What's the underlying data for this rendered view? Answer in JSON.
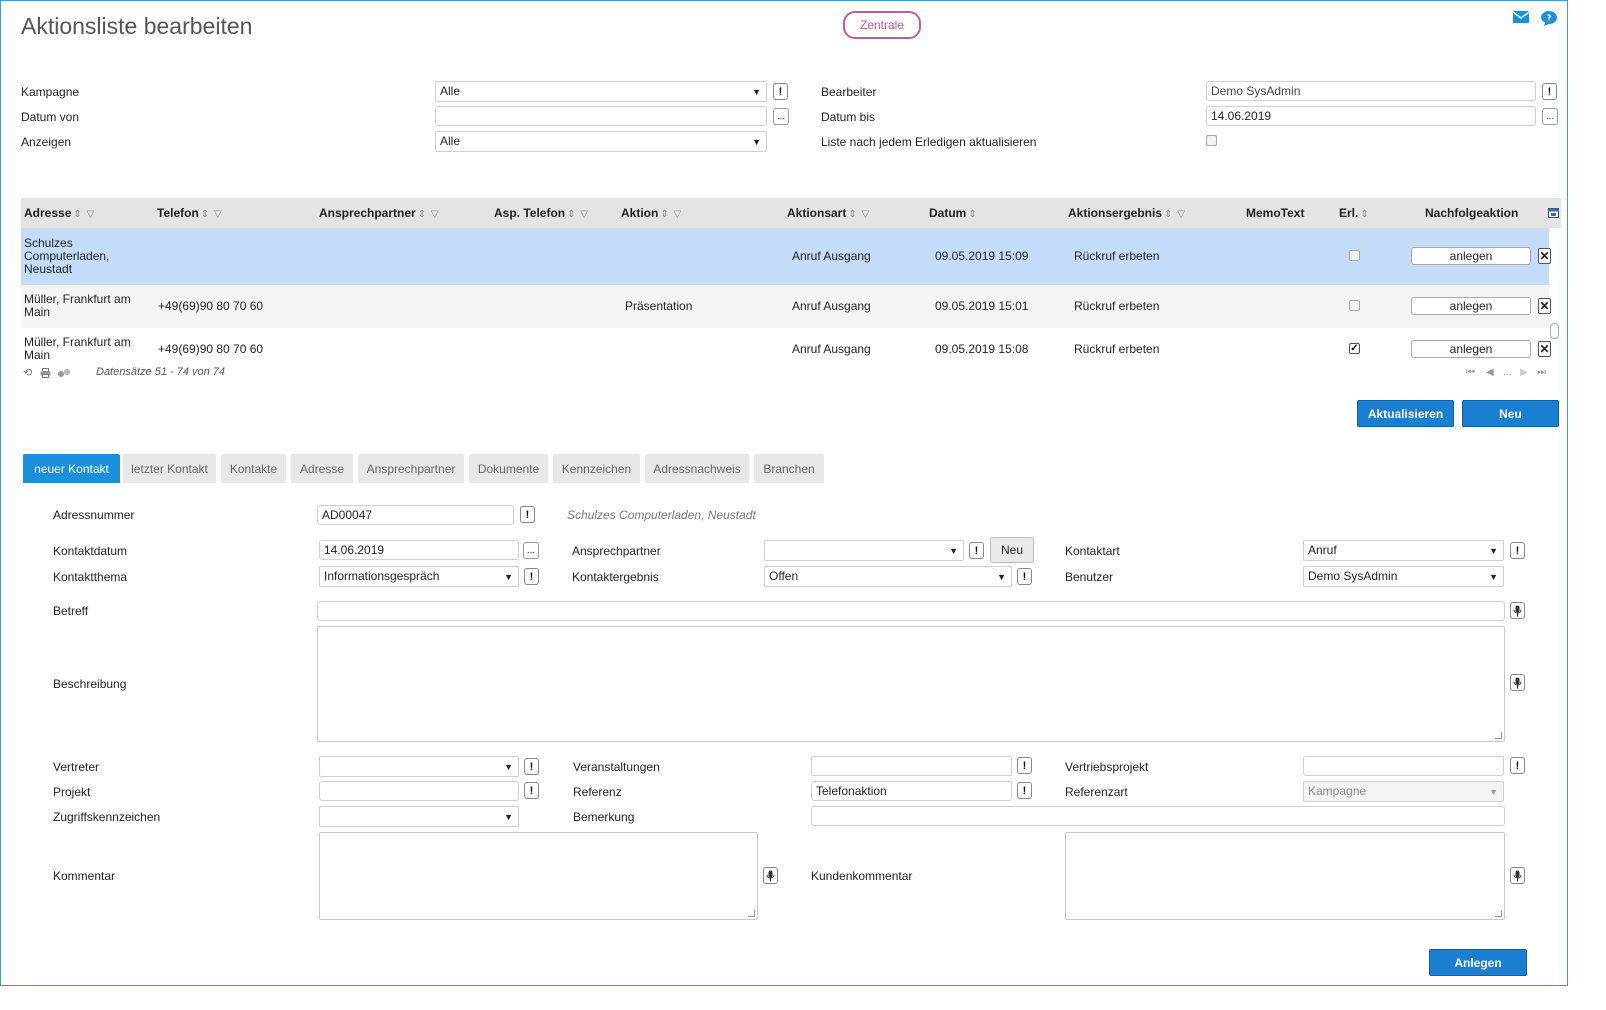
{
  "header": {
    "title": "Aktionsliste bearbeiten",
    "zentrale": "Zentrale",
    "mail_icon": "mail-icon",
    "help_icon": "help-icon"
  },
  "filters": {
    "kampagne_label": "Kampagne",
    "kampagne_value": "Alle",
    "datum_von_label": "Datum von",
    "datum_von_value": "",
    "anzeigen_label": "Anzeigen",
    "anzeigen_value": "Alle",
    "bearbeiter_label": "Bearbeiter",
    "bearbeiter_value": "Demo SysAdmin",
    "datum_bis_label": "Datum bis",
    "datum_bis_value": "14.06.2019",
    "refresh_label": "Liste nach jedem Erledigen aktualisieren"
  },
  "grid": {
    "columns": [
      "Adresse",
      "Telefon",
      "Ansprechpartner",
      "Asp. Telefon",
      "Aktion",
      "Aktionsart",
      "Datum",
      "Aktionsergebnis",
      "MemoText",
      "Erl.",
      "Nachfolgeaktion"
    ],
    "rows": [
      {
        "adresse": "Schulzes Computerladen, Neustadt",
        "telefon": "",
        "aktion": "",
        "aktionsart": "Anruf Ausgang",
        "datum": "09.05.2019 15:09",
        "ergebnis": "Rückruf erbeten",
        "erl": false,
        "btn": "anlegen"
      },
      {
        "adresse": "Müller, Frankfurt am Main",
        "telefon": "+49(69)90 80 70 60",
        "aktion": "Präsentation",
        "aktionsart": "Anruf Ausgang",
        "datum": "09.05.2019 15:01",
        "ergebnis": "Rückruf erbeten",
        "erl": false,
        "btn": "anlegen"
      },
      {
        "adresse": "Müller, Frankfurt am Main",
        "telefon": "+49(69)90 80 70 60",
        "aktion": "",
        "aktionsart": "Anruf Ausgang",
        "datum": "09.05.2019 15:08",
        "ergebnis": "Rückruf erbeten",
        "erl": true,
        "btn": "anlegen"
      }
    ],
    "records": "Datensätze 51 - 74 von 74",
    "pager_dots": "..."
  },
  "actions": {
    "aktualisieren": "Aktualisieren",
    "neu": "Neu"
  },
  "tabs": [
    "neuer Kontakt",
    "letzter Kontakt",
    "Kontakte",
    "Adresse",
    "Ansprechpartner",
    "Dokumente",
    "Kennzeichen",
    "Adressnachweis",
    "Branchen"
  ],
  "form": {
    "adressnummer_label": "Adressnummer",
    "adressnummer_value": "AD00047",
    "adresse_hint": "Schulzes Computerladen, Neustadt",
    "kontaktdatum_label": "Kontaktdatum",
    "kontaktdatum_value": "14.06.2019",
    "ansprechpartner_label": "Ansprechpartner",
    "ansprechpartner_value": "",
    "ansprechpartner_neu": "Neu",
    "kontaktart_label": "Kontaktart",
    "kontaktart_value": "Anruf",
    "kontaktthema_label": "Kontaktthema",
    "kontaktthema_value": "Informationsgespräch",
    "kontaktergebnis_label": "Kontaktergebnis",
    "kontaktergebnis_value": "Offen",
    "benutzer_label": "Benutzer",
    "benutzer_value": "Demo SysAdmin",
    "betreff_label": "Betreff",
    "betreff_value": "",
    "beschreibung_label": "Beschreibung",
    "vertreter_label": "Vertreter",
    "vertreter_value": "",
    "veranstaltungen_label": "Veranstaltungen",
    "veranstaltungen_value": "",
    "vertriebsprojekt_label": "Vertriebsprojekt",
    "vertriebsprojekt_value": "",
    "projekt_label": "Projekt",
    "projekt_value": "",
    "referenz_label": "Referenz",
    "referenz_value": "Telefonaktion",
    "referenzart_label": "Referenzart",
    "referenzart_value": "Kampagne",
    "zugriff_label": "Zugriffskennzeichen",
    "zugriff_value": "",
    "bemerkung_label": "Bemerkung",
    "bemerkung_value": "",
    "kommentar_label": "Kommentar",
    "kundenkommentar_label": "Kundenkommentar",
    "anlegen": "Anlegen"
  }
}
